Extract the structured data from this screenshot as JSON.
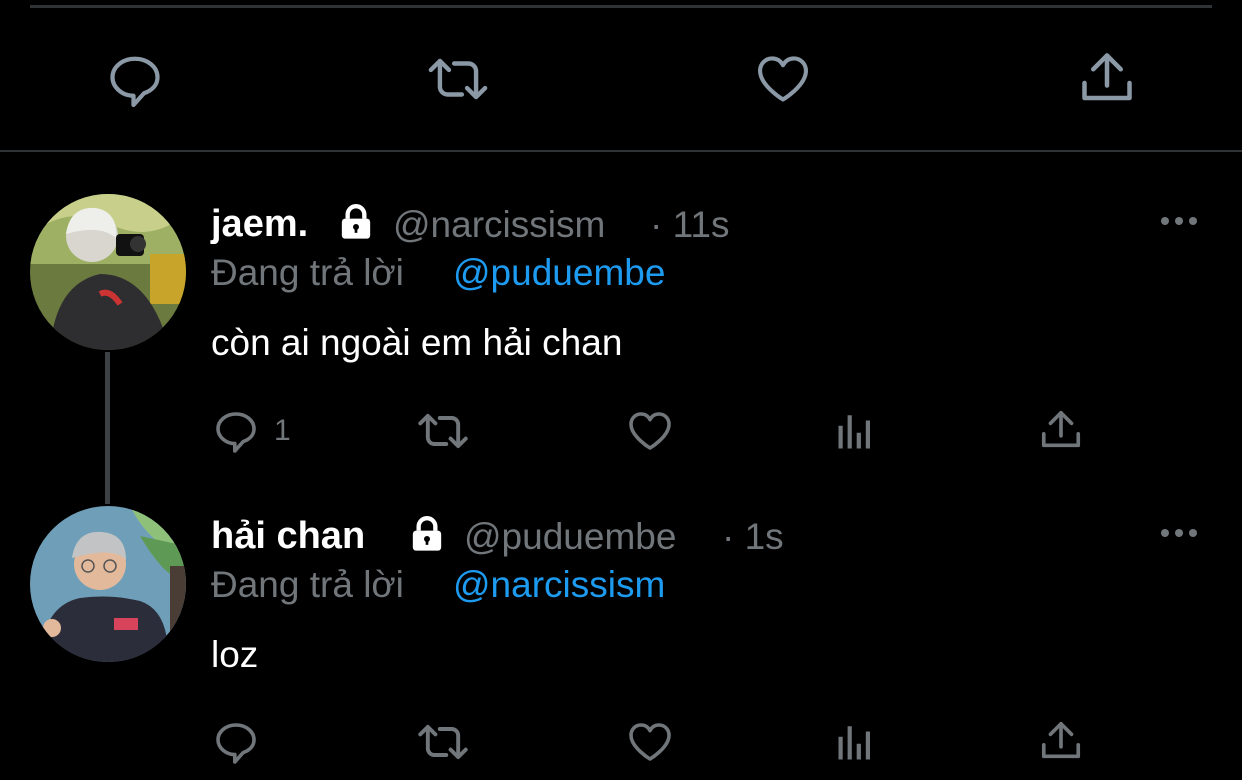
{
  "main_tweet_actions": {
    "reply": "reply-icon",
    "retweet": "retweet-icon",
    "like": "heart-icon",
    "share": "share-icon"
  },
  "replies": [
    {
      "display_name": "jaem.",
      "handle": "@narcissism",
      "time": "· 11s",
      "reply_prefix": "Đang trả lời",
      "reply_to": "@puduembe",
      "text": "còn ai ngoài em hải chan",
      "reply_count": "1",
      "locked": true
    },
    {
      "display_name": "hải chan",
      "handle": "@puduembe",
      "time": "· 1s",
      "reply_prefix": "Đang trả lời",
      "reply_to": "@narcissism",
      "text": "loz",
      "reply_count": "",
      "locked": true
    }
  ],
  "colors": {
    "background": "#000000",
    "icon_gray": "#71767b",
    "link_blue": "#1d9bf0",
    "divider": "#2f3336"
  }
}
